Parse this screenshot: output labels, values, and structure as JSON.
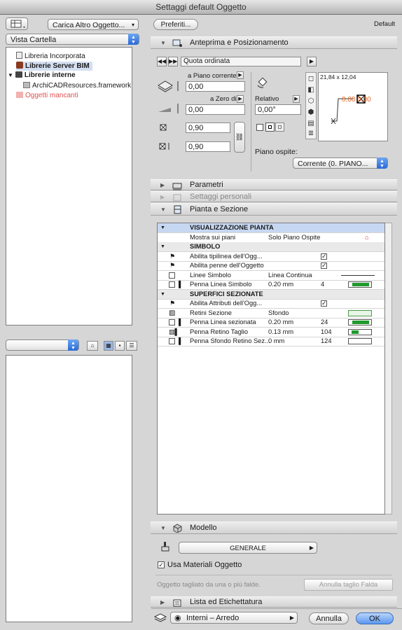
{
  "window": {
    "title": "Settaggi default Oggetto"
  },
  "library": {
    "load_button": "Carica Altro Oggetto...",
    "view_select": "Vista Cartella",
    "items": [
      {
        "label": "Libreria Incorporata"
      },
      {
        "label": "Librerie Server BIM"
      },
      {
        "label": "Librerie interne"
      },
      {
        "label": "ArchiCADResources.framework"
      },
      {
        "label": "Oggetti mancanti"
      }
    ]
  },
  "header": {
    "favorites_button": "Preferiti...",
    "status": "Default"
  },
  "preview": {
    "section_title": "Anteprima e Posizionamento",
    "elevation_mode": "Quota ordinata",
    "to_current_story_label": "a Piano corrente",
    "to_current_story_value": "0,00",
    "to_zero_label": "a Zero di",
    "to_zero_value": "0,00",
    "width_value": "0,90",
    "depth_value": "0,90",
    "relative_label": "Relativo",
    "angle_value": "0,00°",
    "size_readout": "21,84 x 12,04",
    "coord_readout": "0,00 0,00",
    "host_story_label": "Piano ospite:",
    "host_story_value": "Corrente (0. PIANO..."
  },
  "sections": {
    "parameters": "Parametri",
    "custom_settings": "Settaggi personali",
    "floor_plan": "Pianta e Sezione",
    "model": "Modello",
    "listing": "Lista ed Etichettatura"
  },
  "grid": {
    "rows": [
      {
        "label": "VISUALIZZAZIONE PIANTA",
        "value": "",
        "num": "",
        "type": "sel"
      },
      {
        "label": "Mostra sui piani",
        "value": "Solo Piano Ospite",
        "num": "",
        "type": "row"
      },
      {
        "label": "SIMBOLO",
        "value": "",
        "num": "",
        "type": "hdr"
      },
      {
        "label": "Abilita tipilinea dell'Ogg...",
        "value": "",
        "num": "",
        "type": "check"
      },
      {
        "label": "Abilita penne dell'Oggetto",
        "value": "",
        "num": "",
        "type": "check"
      },
      {
        "label": "Linee Simbolo",
        "value": "Linea Continua",
        "num": "",
        "type": "line"
      },
      {
        "label": "Penna Linea Simbolo",
        "value": "0.20 mm",
        "num": "4",
        "type": "pen"
      },
      {
        "label": "SUPERFICI SEZIONATE",
        "value": "",
        "num": "",
        "type": "hdr"
      },
      {
        "label": "Abilita Attributi dell'Ogg...",
        "value": "",
        "num": "",
        "type": "check"
      },
      {
        "label": "Retini Sezione",
        "value": "Sfondo",
        "num": "",
        "type": "fill"
      },
      {
        "label": "Penna Linea sezionata",
        "value": "0.20 mm",
        "num": "24",
        "type": "pen"
      },
      {
        "label": "Penna Retino Taglio",
        "value": "0.13 mm",
        "num": "104",
        "type": "pen2"
      },
      {
        "label": "Penna Sfondo Retino Sez...",
        "value": "0 mm",
        "num": "124",
        "type": "pen3"
      }
    ]
  },
  "model": {
    "surface_select": "GENERALE",
    "use_object_materials_label": "Usa Materiali Oggetto",
    "cut_info": "Oggetto tagliato da una o più falde.",
    "undo_cut_button": "Annulla taglio Falda"
  },
  "footer": {
    "layer_select": "Interni – Arredo",
    "cancel_button": "Annulla",
    "ok_button": "OK"
  },
  "colors": {
    "accent": "#2a69d8",
    "pen_green": "#1f9a2c",
    "missing_red": "#e05050"
  }
}
